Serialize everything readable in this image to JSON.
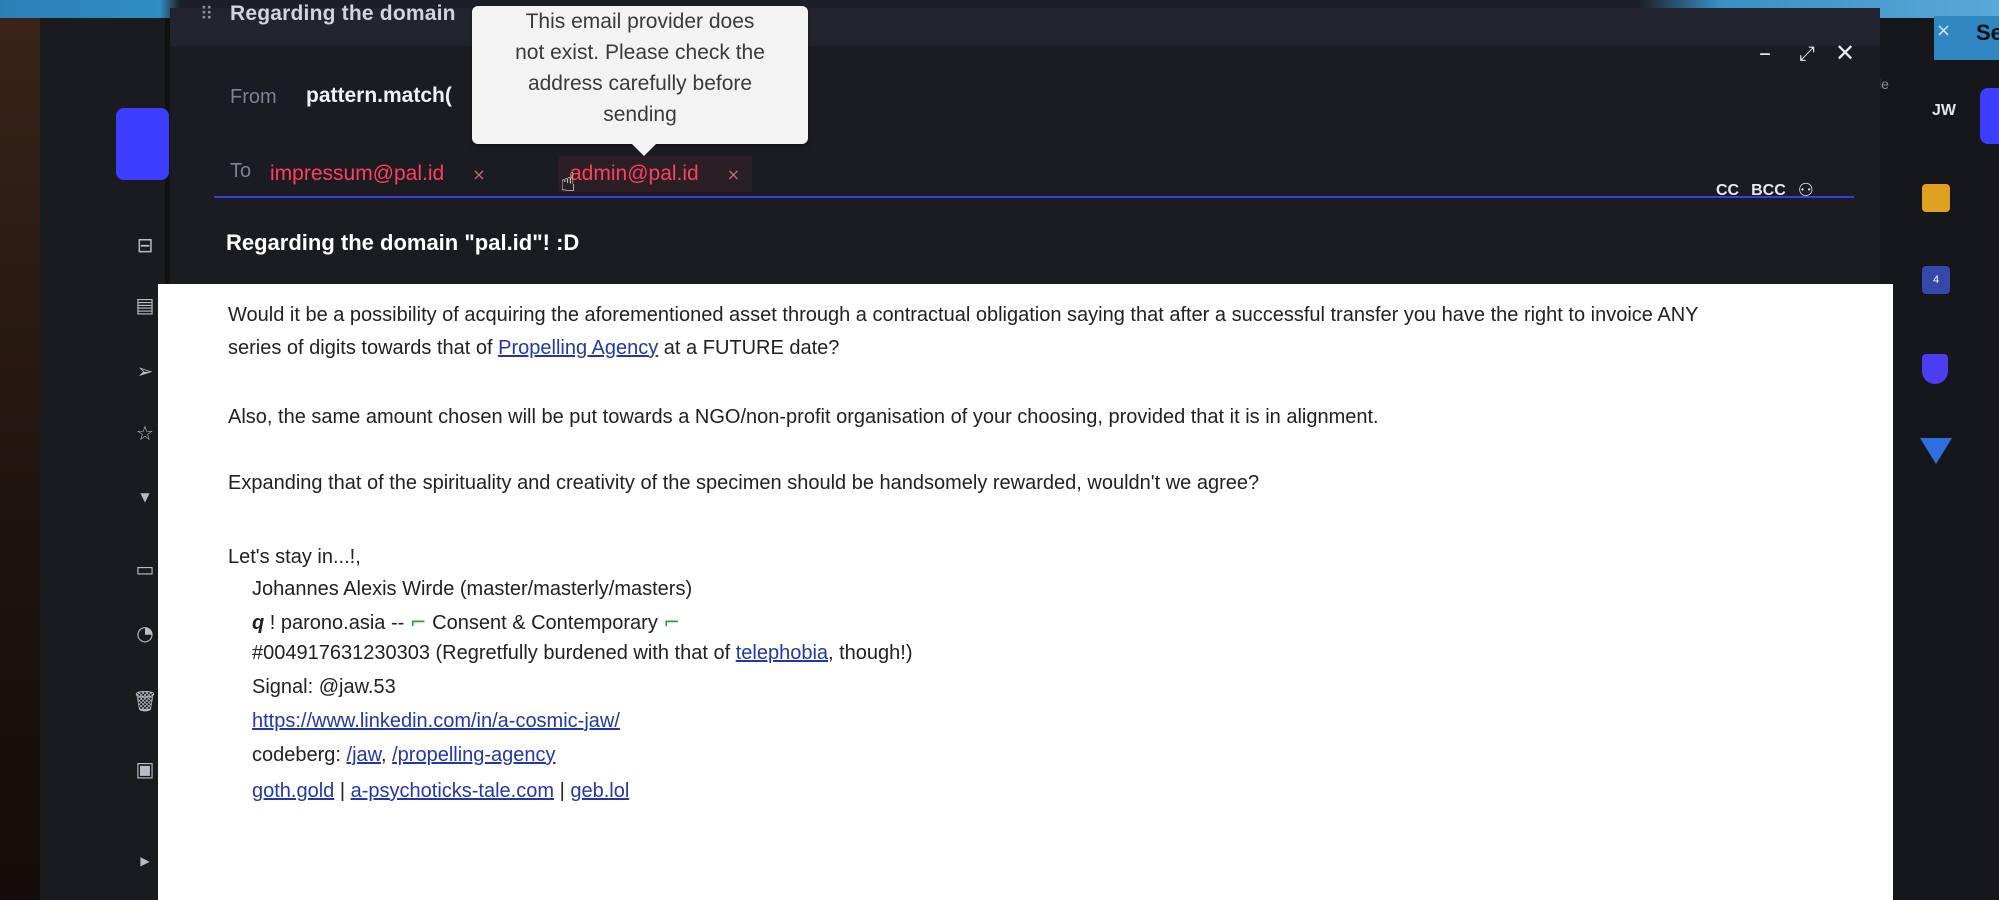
{
  "tooltip": {
    "lines": [
      "This email provider does",
      "not exist. Please check the",
      "address carefully before",
      "sending"
    ]
  },
  "composer": {
    "title": "Regarding the domain",
    "from_label": "From",
    "from_value": "pattern.match(",
    "to_label": "To",
    "recipients": [
      {
        "address": "impressum@pal.id",
        "remove": "×"
      },
      {
        "address": "admin@pal.id",
        "remove": "×"
      }
    ],
    "cc": "CC",
    "bcc": "BCC",
    "subject": "Regarding the domain \"pal.id\"! :D"
  },
  "body": {
    "p1_line1": "Would it be a possibility of acquiring the aforementioned asset through a contractual obligation saying that after a successful transfer you have the right to invoice ANY",
    "p1_line2_pre": "series of digits towards that of ",
    "p1_link": "Propelling Agency",
    "p1_line2_post": " at a FUTURE date?",
    "p2": "Also, the same amount chosen will be put towards a NGO/non-profit organisation of your choosing, provided that it is in alignment.",
    "p3": "Expanding that of the spirituality and creativity of the specimen should be handsomely rewarded, wouldn't we agree?",
    "closing": "Let's stay in...!,",
    "sig_name": "Johannes Alexis Wirde (master/masterly/masters)",
    "sig_q": "q",
    "sig_line2": " ! parono.asia -- ",
    "sig_tagline": " Consent & Contemporary ",
    "sig_phone_pre": "#004917631230303 (Regretfully burdened with that of ",
    "sig_phone_link": "telephobia",
    "sig_phone_post": ", though!)",
    "sig_signal": "Signal: @jaw.53",
    "sig_linkedin": "https://www.linkedin.com/in/a-cosmic-jaw/",
    "sig_codeberg_label": "codeberg: ",
    "sig_codeberg_link1": "/jaw",
    "sig_codeberg_sep": ", ",
    "sig_codeberg_link2": "/propelling-agency",
    "sig_link_a": "goth.gold",
    "sig_sep": " | ",
    "sig_link_b": "a-psychoticks-tale.com",
    "sig_link_c": "geb.lol"
  },
  "right_panel": {
    "avatar_initials": "JW",
    "calendar_badge": "4",
    "truncated_top": "Se",
    "side_text": "le"
  },
  "colors": {
    "accent": "#3d3dff",
    "error_chip_text": "#ff3f5c",
    "link": "#2238a8"
  }
}
